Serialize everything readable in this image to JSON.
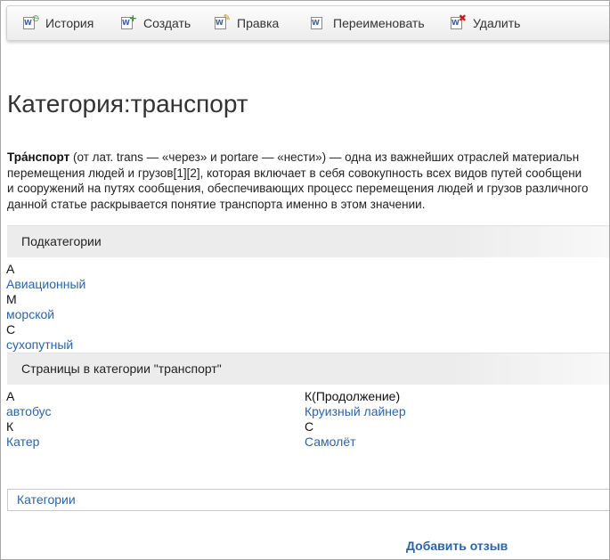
{
  "toolbar": {
    "history": "История",
    "create": "Создать",
    "edit": "Правка",
    "rename": "Переименовать",
    "delete": "Удалить"
  },
  "page_title": "Категория:транспорт",
  "intro": {
    "term": "Тра́нспорт",
    "line1": " (от лат. trans — «через» и portare — «нести») — одна из важнейших отраслей материальн",
    "line2": "перемещения людей и грузов[1][2], которая включает в себя совокупность всех видов путей сообщени",
    "line3": "и сооружений на путях сообщения, обеспечивающих процесс перемещения людей и грузов различного",
    "line4": "данной статье раскрывается понятие транспорта именно в этом значении."
  },
  "subcategories": {
    "header": "Подкатегории",
    "groups": [
      {
        "letter": "А",
        "link": "Авиационный"
      },
      {
        "letter": "М",
        "link": "морской"
      },
      {
        "letter": "С",
        "link": "сухопутный"
      }
    ]
  },
  "pages": {
    "header": "Страницы в категории \"транспорт\"",
    "left": [
      {
        "letter": "А",
        "link": "автобус"
      },
      {
        "letter": "К",
        "link": "Катер"
      }
    ],
    "right": [
      {
        "letter": "К(Продолжение)",
        "link": "Круизный лайнер"
      },
      {
        "letter": "С",
        "link": "Самолёт"
      }
    ]
  },
  "categories_link": "Категории",
  "feedback_link": "Добавить отзыв",
  "colors": {
    "link": "#2b64a8",
    "toolbar_bg": "#f2f2f2",
    "section_bg": "#ececec"
  }
}
